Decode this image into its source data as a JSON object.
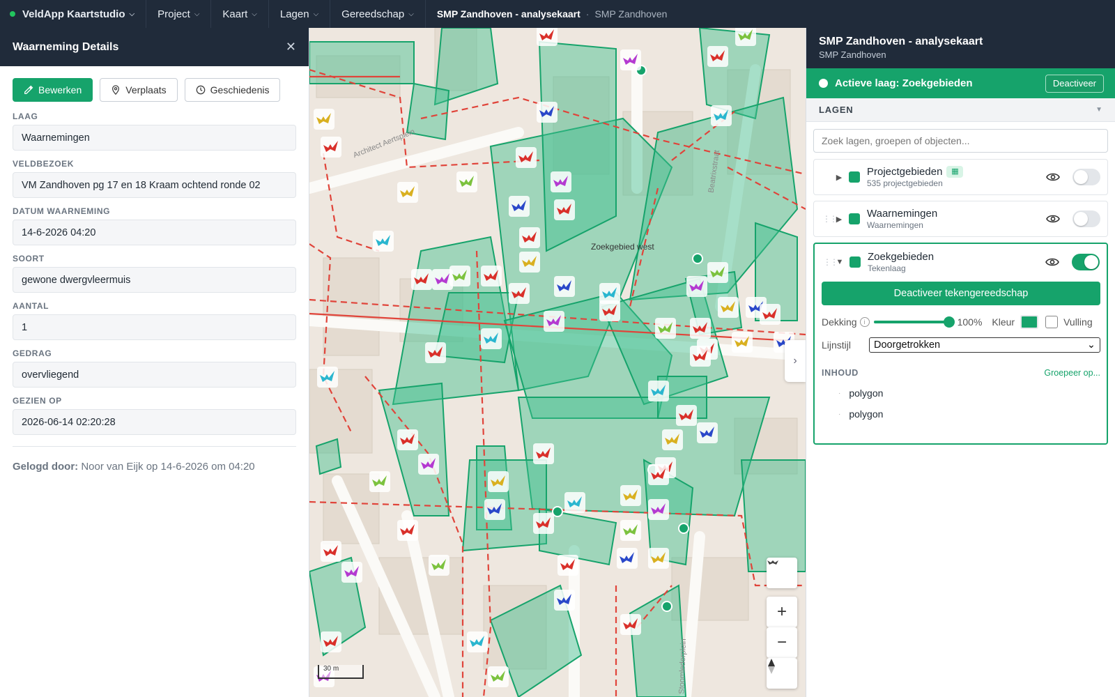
{
  "topbar": {
    "brand": "VeldApp Kaartstudio",
    "menus": [
      {
        "label": "Project"
      },
      {
        "label": "Kaart"
      },
      {
        "label": "Lagen"
      },
      {
        "label": "Gereedschap"
      }
    ],
    "context_title": "SMP Zandhoven - analysekaart",
    "context_separator": "·",
    "context_project": "SMP Zandhoven"
  },
  "left_panel": {
    "title": "Waarneming Details",
    "close_icon": "close-icon",
    "buttons": {
      "edit": "Bewerken",
      "move": "Verplaats",
      "history": "Geschiedenis"
    },
    "fields": [
      {
        "label": "LAAG",
        "value": "Waarnemingen"
      },
      {
        "label": "VELDBEZOEK",
        "value": "VM Zandhoven pg 17 en 18 Kraam ochtend ronde 02"
      },
      {
        "label": "DATUM WAARNEMING",
        "value": "14-6-2026 04:20"
      },
      {
        "label": "SOORT",
        "value": "gewone dwergvleermuis"
      },
      {
        "label": "AANTAL",
        "value": "1"
      },
      {
        "label": "GEDRAG",
        "value": "overvliegend"
      },
      {
        "label": "GEZIEN OP",
        "value": "2026-06-14 02:20:28"
      }
    ],
    "logged_label": "Gelogd door:",
    "logged_text": "Noor van Eijk op 14-6-2026 om 04:20"
  },
  "map": {
    "area_label": "Zoekgebied west",
    "street_labels": {
      "architect": "Architect Aertsplein",
      "beatrix": "Beatrixstraat",
      "stoomleder": "Stoomlederplein"
    },
    "scale": "30 m",
    "controls": {
      "zoom_in": "+",
      "zoom_out": "−",
      "compass": "compass-icon",
      "locate": "bat-icon",
      "expand": "›"
    },
    "colors": {
      "area_fill": "#3dbf8e",
      "area_stroke": "#16a36b",
      "dashed_line": "#e0443a",
      "marker_red": "#d9302a",
      "marker_purple": "#b43ad1",
      "marker_yellow": "#d9b020",
      "marker_cyan": "#2ab6cf",
      "marker_green": "#7cc23e",
      "marker_blue": "#2a48c9"
    }
  },
  "right_panel": {
    "title": "SMP Zandhoven - analysekaart",
    "subtitle": "SMP Zandhoven",
    "active_layer": "Actieve laag: Zoekgebieden",
    "deactivate": "Deactiveer",
    "layers_header": "LAGEN",
    "search_placeholder": "Zoek lagen, groepen of objecten...",
    "layers": [
      {
        "name": "Projectgebieden",
        "sub": "535 projectgebieden",
        "visible": false,
        "badge": "map-icon"
      },
      {
        "name": "Waarnemingen",
        "sub": "Waarnemingen",
        "visible": false
      },
      {
        "name": "Zoekgebieden",
        "sub": "Tekenlaag",
        "visible": true
      }
    ],
    "draw_button": "Deactiveer tekengereedschap",
    "opacity_label": "Dekking",
    "opacity_value": "100%",
    "opacity_fraction": 1.0,
    "color_label": "Kleur",
    "color_value": "#16a36b",
    "fill_label": "Vulling",
    "fill_checked": false,
    "linestyle_label": "Lijnstijl",
    "linestyle_value": "Doorgetrokken",
    "content_label": "INHOUD",
    "group_by": "Groepeer op...",
    "content_items": [
      "polygon",
      "polygon"
    ]
  }
}
